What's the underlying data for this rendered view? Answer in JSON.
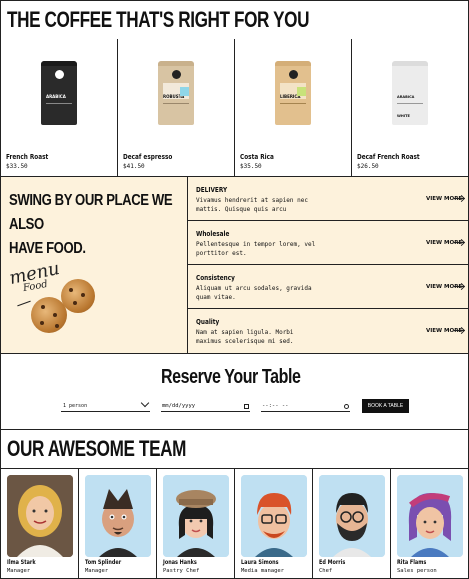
{
  "header": {
    "title": "THE COFFEE THAT'S RIGHT FOR YOU"
  },
  "products": [
    {
      "name": "French Roast",
      "price": "$33.50",
      "bag_color": "#2a2a2a",
      "label_color": "#2a2a2a",
      "bag_label": "ARABICA"
    },
    {
      "name": "Decaf espresso",
      "price": "$41.50",
      "bag_color": "#d8c4a3",
      "label_color": "#8fd6e8",
      "bag_label": "ROBUSTA"
    },
    {
      "name": "Costa Rica",
      "price": "$35.50",
      "bag_color": "#e2c08e",
      "label_color": "#c8e27a",
      "bag_label": "LIBERICA"
    },
    {
      "name": "Decaf French Roast",
      "price": "$26.50",
      "bag_color": "#ececec",
      "label_color": "#ffffff",
      "bag_label": "ARABICA WHITE"
    }
  ],
  "food": {
    "heading_line1": "SWING BY OUR PLACE WE",
    "heading_line2": "ALSO",
    "heading_line3": "HAVE FOOD.",
    "menu_word": "menu",
    "food_word": "Food",
    "items": [
      {
        "title": "DELIVERY",
        "desc": "Vivamus hendrerit at sapien nec mattis. Quisque quis arcu",
        "link": "VIEW MORE"
      },
      {
        "title": "Wholesale",
        "desc": "Pellentesque in tempor lorem, vel porttitor est.",
        "link": "VIEW MORE"
      },
      {
        "title": "Consistency",
        "desc": "Aliquam ut arcu sodales, gravida quam vitae.",
        "link": "VIEW MORE"
      },
      {
        "title": "Quality",
        "desc": "Nam at sapien ligula. Morbi maximus scelerisque mi sed.",
        "link": "VIEW MORE"
      }
    ]
  },
  "reserve": {
    "title": "Reserve Your Table",
    "persons": "1 person",
    "date_placeholder": "mm/dd/yyyy",
    "time_placeholder": "--:-- --",
    "button": "BOOK A TABLE"
  },
  "team": {
    "title": "OUR AWESOME TEAM",
    "members": [
      {
        "name": "Ilma Stark",
        "role": "Manager"
      },
      {
        "name": "Tom Splinder",
        "role": "Manager"
      },
      {
        "name": "Jonas Hanks",
        "role": "Pastry Chef"
      },
      {
        "name": "Laura Simons",
        "role": "Media manager"
      },
      {
        "name": "Ed Morris",
        "role": "Chef"
      },
      {
        "name": "Rita Flams",
        "role": "Sales person"
      }
    ]
  }
}
